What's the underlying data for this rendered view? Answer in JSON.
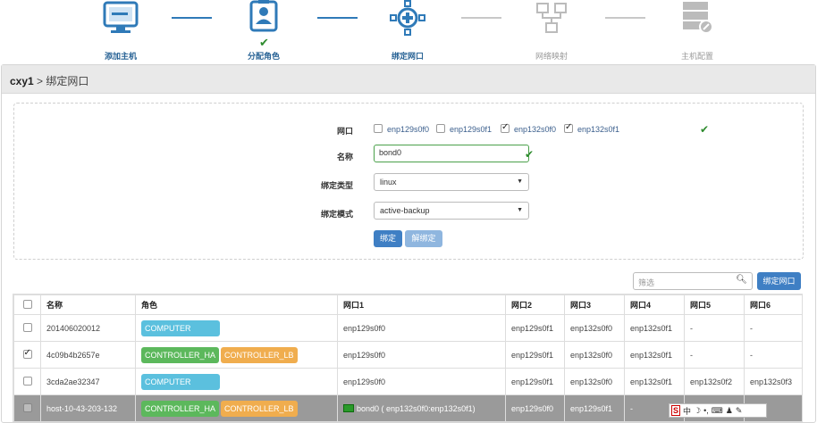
{
  "wizard": {
    "steps": [
      {
        "label": "添加主机",
        "icon": "monitor-icon",
        "state": "done"
      },
      {
        "label": "分配角色",
        "icon": "id-card-icon",
        "state": "done"
      },
      {
        "label": "绑定网口",
        "icon": "network-hub-icon",
        "state": "active"
      },
      {
        "label": "网络映射",
        "icon": "network-map-icon",
        "state": "pending"
      },
      {
        "label": "主机配置",
        "icon": "server-config-icon",
        "state": "pending"
      }
    ],
    "check": "✔"
  },
  "panel": {
    "host": "cxy1",
    "separator": " > ",
    "title": "绑定网口"
  },
  "form": {
    "port_label": "网口",
    "ports": [
      {
        "name": "enp129s0f0",
        "checked": false
      },
      {
        "name": "enp129s0f1",
        "checked": false
      },
      {
        "name": "enp132s0f0",
        "checked": true
      },
      {
        "name": "enp132s0f1",
        "checked": true
      }
    ],
    "name_label": "名称",
    "name_value": "bond0",
    "bind_type_label": "绑定类型",
    "bind_type_value": "linux",
    "bind_mode_label": "绑定模式",
    "bind_mode_value": "active-backup",
    "bind_button": "绑定",
    "unbind_button": "解绑定",
    "ok_mark": "✔"
  },
  "toolbar": {
    "search_placeholder": "筛选",
    "bind_port_button": "绑定网口"
  },
  "table": {
    "headers": [
      "名称",
      "角色",
      "网口1",
      "网口2",
      "网口3",
      "网口4",
      "网口5",
      "网口6"
    ],
    "rows": [
      {
        "checked": false,
        "name": "201406020012",
        "roles": [
          {
            "text": "COMPUTER",
            "color": "blue"
          }
        ],
        "p1": "enp129s0f0",
        "p2": "enp129s0f1",
        "p3": "enp132s0f0",
        "p4": "enp132s0f1",
        "p5": "-",
        "p6": "-"
      },
      {
        "checked": true,
        "name": "4c09b4b2657e",
        "roles": [
          {
            "text": "CONTROLLER_HA",
            "color": "green"
          },
          {
            "text": "CONTROLLER_LB",
            "color": "orange"
          }
        ],
        "p1": "enp129s0f0",
        "p2": "enp129s0f1",
        "p3": "enp132s0f0",
        "p4": "enp132s0f1",
        "p5": "-",
        "p6": "-"
      },
      {
        "checked": false,
        "name": "3cda2ae32347",
        "roles": [
          {
            "text": "COMPUTER",
            "color": "blue"
          }
        ],
        "p1": "enp129s0f0",
        "p2": "enp129s0f1",
        "p3": "enp132s0f0",
        "p4": "enp132s0f1",
        "p5": "enp132s0f2",
        "p6": "enp132s0f3"
      },
      {
        "checked": false,
        "name": "host-10-43-203-132",
        "roles": [
          {
            "text": "CONTROLLER_HA",
            "color": "green"
          },
          {
            "text": "CONTROLLER_LB",
            "color": "orange"
          }
        ],
        "p1": "bond0 ( enp132s0f0:enp132s0f1)",
        "p2": "enp129s0f0",
        "p3": "enp129s0f1",
        "p4": "-",
        "p5": "-",
        "p6": "-",
        "highlight": true,
        "bond": true
      }
    ]
  },
  "ime": {
    "s_label": "S",
    "zh": "中",
    "icons": [
      "moon-icon",
      "punctuation-icon",
      "keyboard-icon",
      "user-icon",
      "wrench-icon"
    ],
    "glyphs": [
      "☽",
      "•,",
      "⌨",
      "♟",
      "✎"
    ]
  },
  "colors": {
    "accent": "#3f7fc4",
    "success": "#2e8b2e",
    "tag_blue": "#5bc0de",
    "tag_green": "#5cb85c",
    "tag_orange": "#f0ad4e",
    "highlight_row": "#9a9a9a"
  }
}
